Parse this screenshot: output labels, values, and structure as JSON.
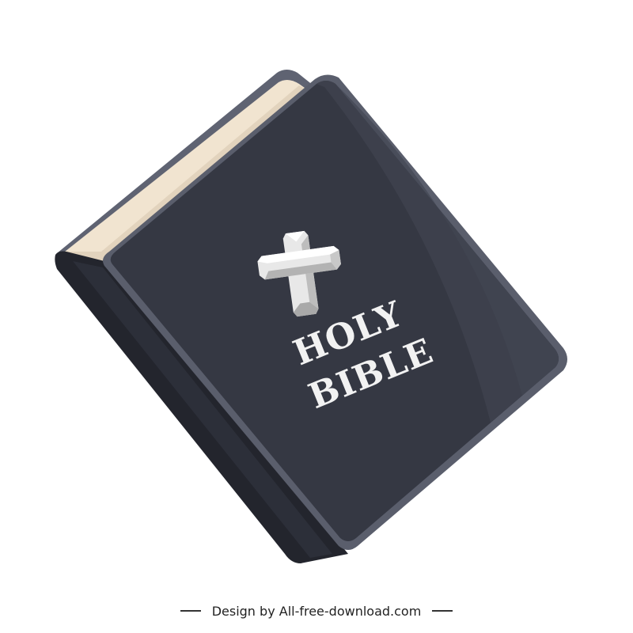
{
  "cover": {
    "title_line1": "HOLY",
    "title_line2": "BIBLE",
    "symbol": "cross-icon"
  },
  "colors": {
    "cover": "#353843",
    "cover_edge": "#5a5e6c",
    "spine": "#23252d",
    "pages": "#f1e4d0",
    "cross": "#e8e8e8"
  },
  "footer": {
    "credit": "Design by All-free-download.com"
  }
}
